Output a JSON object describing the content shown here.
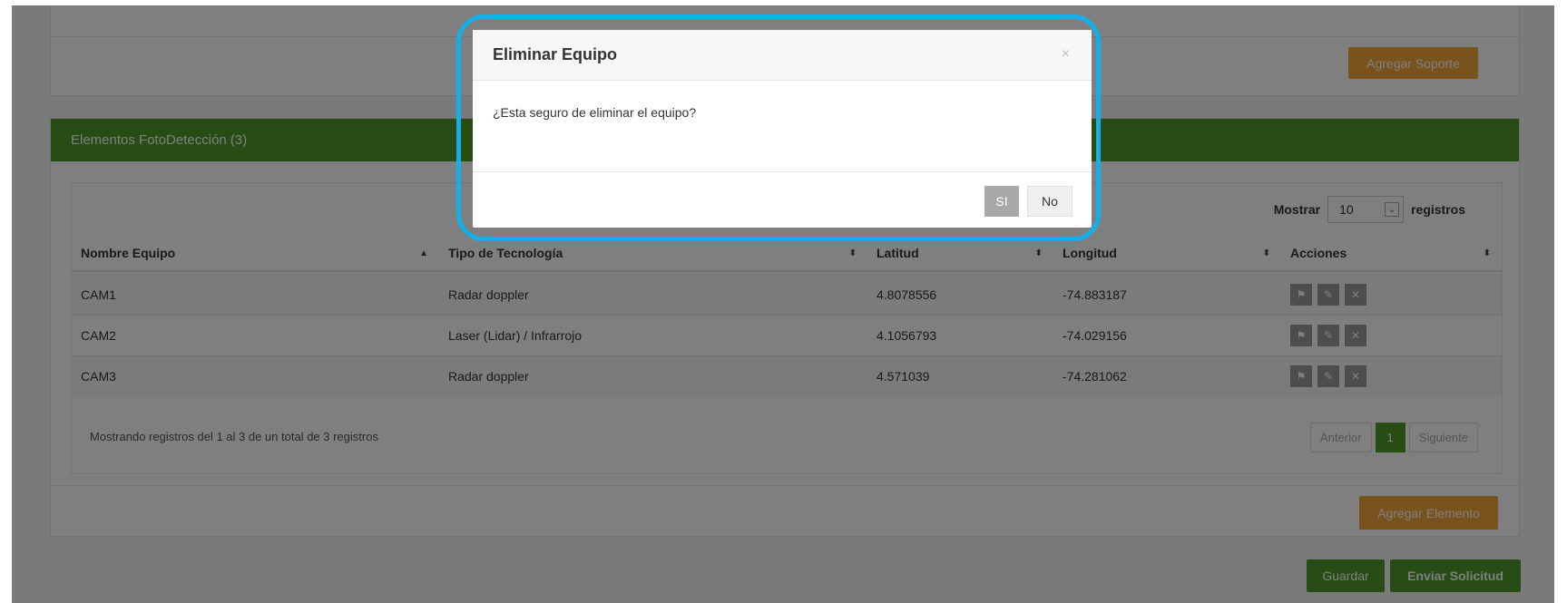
{
  "support": {
    "add_button": "Agregar Soporte"
  },
  "foto": {
    "header": "Elementos FotoDetección (3)",
    "show_label": "Mostrar",
    "show_value": "10",
    "show_suffix": "registros",
    "columns": [
      "Nombre Equipo",
      "Tipo de Tecnología",
      "Latitud",
      "Longitud",
      "Acciones"
    ],
    "rows": [
      {
        "name": "CAM1",
        "tech": "Radar doppler",
        "lat": "4.8078556",
        "lon": "-74.883187"
      },
      {
        "name": "CAM2",
        "tech": "Laser (Lidar) / Infrarrojo",
        "lat": "4.1056793",
        "lon": "-74.029156"
      },
      {
        "name": "CAM3",
        "tech": "Radar doppler",
        "lat": "4.571039",
        "lon": "-74.281062"
      }
    ],
    "info": "Mostrando registros del 1 al 3 de un total de 3 registros",
    "pager": {
      "prev": "Anterior",
      "current": "1",
      "next": "Siguiente"
    },
    "add_button": "Agregar Elemento"
  },
  "actions": {
    "save": "Guardar",
    "send": "Enviar Solicitud"
  },
  "modal": {
    "title": "Eliminar Equipo",
    "close": "×",
    "message": "¿Esta seguro de eliminar el equipo?",
    "yes": "SI",
    "no": "No"
  },
  "colors": {
    "header_green": "#4e9a2b",
    "orange": "#f3a73b",
    "highlight": "#16aee6"
  },
  "icons": {
    "row_actions": [
      "flag-icon",
      "pencil-icon",
      "close-icon"
    ]
  }
}
